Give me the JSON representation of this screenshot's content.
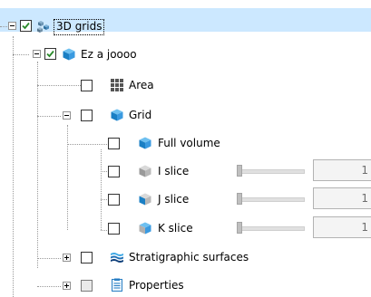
{
  "tree": {
    "root": {
      "label": "3D grids",
      "icon": "3d-grids-icon",
      "checked": true,
      "expanded": true,
      "selected": true
    },
    "project": {
      "label": "Ez a joooo",
      "icon": "grid-cube-icon",
      "checked": true,
      "expanded": true
    },
    "area": {
      "label": "Area",
      "icon": "area-grid-icon",
      "checked": false
    },
    "grid": {
      "label": "Grid",
      "icon": "grid-cube-icon",
      "checked": false,
      "expanded": true
    },
    "full_volume": {
      "label": "Full volume",
      "icon": "grid-cube-icon",
      "checked": false
    },
    "i_slice": {
      "label": "I slice",
      "icon": "gray-cube-icon",
      "checked": false,
      "value": "1"
    },
    "j_slice": {
      "label": "J slice",
      "icon": "blue-gray-cube-icon",
      "checked": false,
      "value": "1"
    },
    "k_slice": {
      "label": "K slice",
      "icon": "blue-cube-icon",
      "checked": false,
      "value": "1"
    },
    "stratigraphic": {
      "label": "Stratigraphic surfaces",
      "icon": "surfaces-icon",
      "checked": false,
      "expanded": false
    },
    "properties": {
      "label": "Properties",
      "icon": "properties-icon",
      "checked": false,
      "expanded": false
    }
  },
  "colors": {
    "selection": "#cce8ff",
    "check": "#2a8a2a",
    "cube_blue": "#1f8fd6"
  }
}
